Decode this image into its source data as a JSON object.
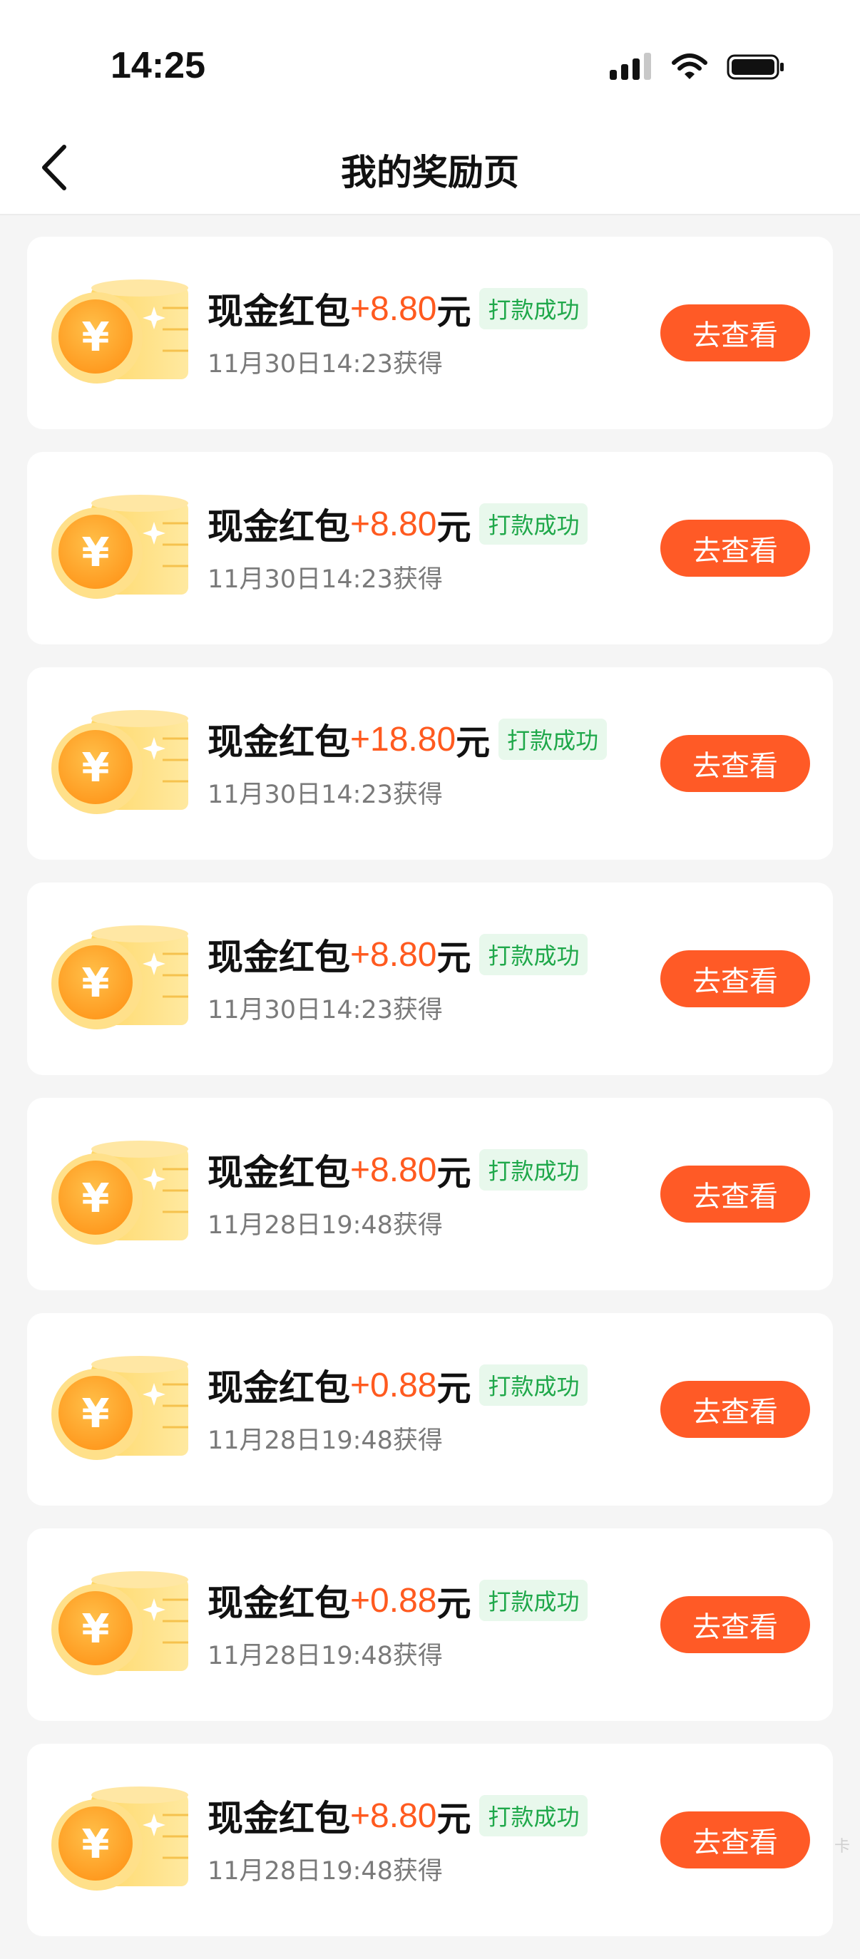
{
  "status_bar": {
    "time": "14:25"
  },
  "nav": {
    "title": "我的奖励页"
  },
  "rewards": [
    {
      "label": "现金红包",
      "amount": "+8.80",
      "unit": "元",
      "status": "打款成功",
      "date": "11月30日14:23获得",
      "button": "去查看"
    },
    {
      "label": "现金红包",
      "amount": "+8.80",
      "unit": "元",
      "status": "打款成功",
      "date": "11月30日14:23获得",
      "button": "去查看"
    },
    {
      "label": "现金红包",
      "amount": "+18.80",
      "unit": "元",
      "status": "打款成功",
      "date": "11月30日14:23获得",
      "button": "去查看"
    },
    {
      "label": "现金红包",
      "amount": "+8.80",
      "unit": "元",
      "status": "打款成功",
      "date": "11月30日14:23获得",
      "button": "去查看"
    },
    {
      "label": "现金红包",
      "amount": "+8.80",
      "unit": "元",
      "status": "打款成功",
      "date": "11月28日19:48获得",
      "button": "去查看"
    },
    {
      "label": "现金红包",
      "amount": "+0.88",
      "unit": "元",
      "status": "打款成功",
      "date": "11月28日19:48获得",
      "button": "去查看"
    },
    {
      "label": "现金红包",
      "amount": "+0.88",
      "unit": "元",
      "status": "打款成功",
      "date": "11月28日19:48获得",
      "button": "去查看"
    },
    {
      "label": "现金红包",
      "amount": "+8.80",
      "unit": "元",
      "status": "打款成功",
      "date": "11月28日19:48获得",
      "button": "去查看"
    }
  ],
  "watermark": "卡",
  "colors": {
    "accent": "#ff5a26",
    "amount": "#ff5a1f",
    "success": "#1fa84a",
    "success_bg": "#e8f8ec",
    "background": "#f5f5f5"
  },
  "icons": {
    "back": "chevron-left-icon",
    "coin": "coin-stack-icon",
    "signal": "signal-icon",
    "wifi": "wifi-icon",
    "battery": "battery-icon"
  }
}
